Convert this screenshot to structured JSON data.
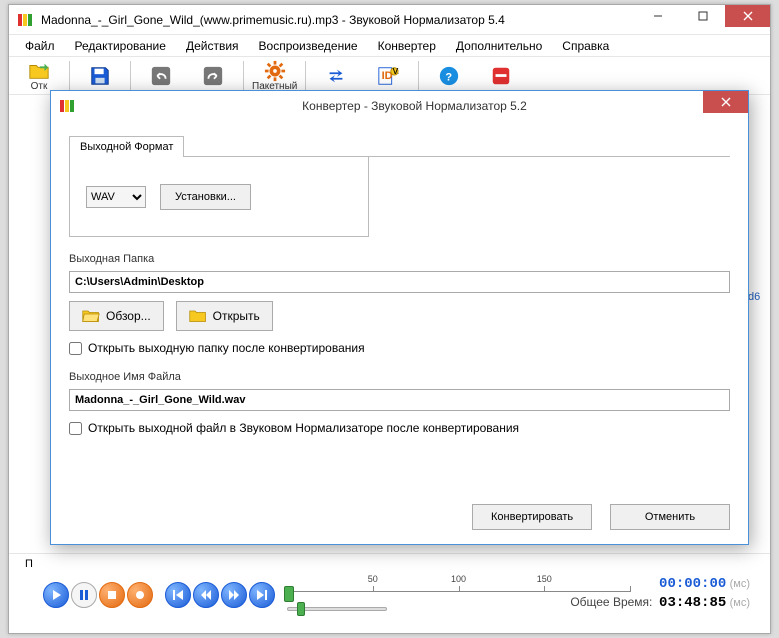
{
  "main_window": {
    "title": "Madonna_-_Girl_Gone_Wild_(www.primemusic.ru).mp3 - Звуковой Нормализатор 5.4"
  },
  "menu": {
    "file": "Файл",
    "edit": "Редактирование",
    "actions": "Действия",
    "playback": "Воспроизведение",
    "converter": "Конвертер",
    "advanced": "Дополнительно",
    "help": "Справка"
  },
  "toolbar": {
    "open": "Отк",
    "batch": "Пакетный"
  },
  "player": {
    "p_label": "П",
    "ruler": {
      "t50": "50",
      "t100": "100",
      "t150": "150"
    },
    "current_time": "00:00:00",
    "ms_unit": "(мс)",
    "total_label": "Общее Время:",
    "total_time": "03:48:85"
  },
  "side_hint": "d6",
  "dialog": {
    "title": "Конвертер - Звуковой Нормализатор 5.2",
    "tab_label": "Выходной Формат",
    "format_selected": "WAV",
    "settings_btn": "Установки...",
    "out_folder_label": "Выходная Папка",
    "out_folder_value": "C:\\Users\\Admin\\Desktop",
    "browse_btn": "Обзор...",
    "open_btn": "Открыть",
    "open_folder_check": "Открыть выходную папку после конвертирования",
    "out_name_label": "Выходное Имя Файла",
    "out_name_value": "Madonna_-_Girl_Gone_Wild.wav",
    "open_file_check": "Открыть выходной файл в Звуковом Нормализаторе после конвертирования",
    "convert_btn": "Конвертировать",
    "cancel_btn": "Отменить"
  }
}
